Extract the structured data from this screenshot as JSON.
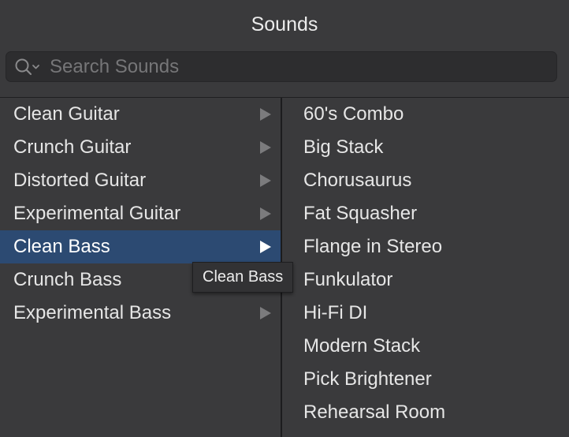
{
  "header": {
    "title": "Sounds"
  },
  "search": {
    "placeholder": "Search Sounds",
    "value": ""
  },
  "categories": [
    {
      "label": "Clean Guitar",
      "selected": false
    },
    {
      "label": "Crunch Guitar",
      "selected": false
    },
    {
      "label": "Distorted Guitar",
      "selected": false
    },
    {
      "label": "Experimental Guitar",
      "selected": false
    },
    {
      "label": "Clean Bass",
      "selected": true
    },
    {
      "label": "Crunch Bass",
      "selected": false
    },
    {
      "label": "Experimental Bass",
      "selected": false
    }
  ],
  "presets": [
    {
      "label": "60's Combo"
    },
    {
      "label": "Big Stack"
    },
    {
      "label": "Chorusaurus"
    },
    {
      "label": "Fat Squasher"
    },
    {
      "label": "Flange in Stereo"
    },
    {
      "label": "Funkulator"
    },
    {
      "label": "Hi-Fi DI"
    },
    {
      "label": "Modern Stack"
    },
    {
      "label": "Pick Brightener"
    },
    {
      "label": "Rehearsal Room"
    }
  ],
  "tooltip": {
    "text": "Clean Bass"
  },
  "colors": {
    "background": "#3a3a3c",
    "selection": "#2c4a72",
    "search_field": "#2d2d2f",
    "text": "#e6e6e6"
  },
  "icons": {
    "search": "magnifier-with-dropdown-icon",
    "submenu": "right-triangle-arrow-icon"
  }
}
